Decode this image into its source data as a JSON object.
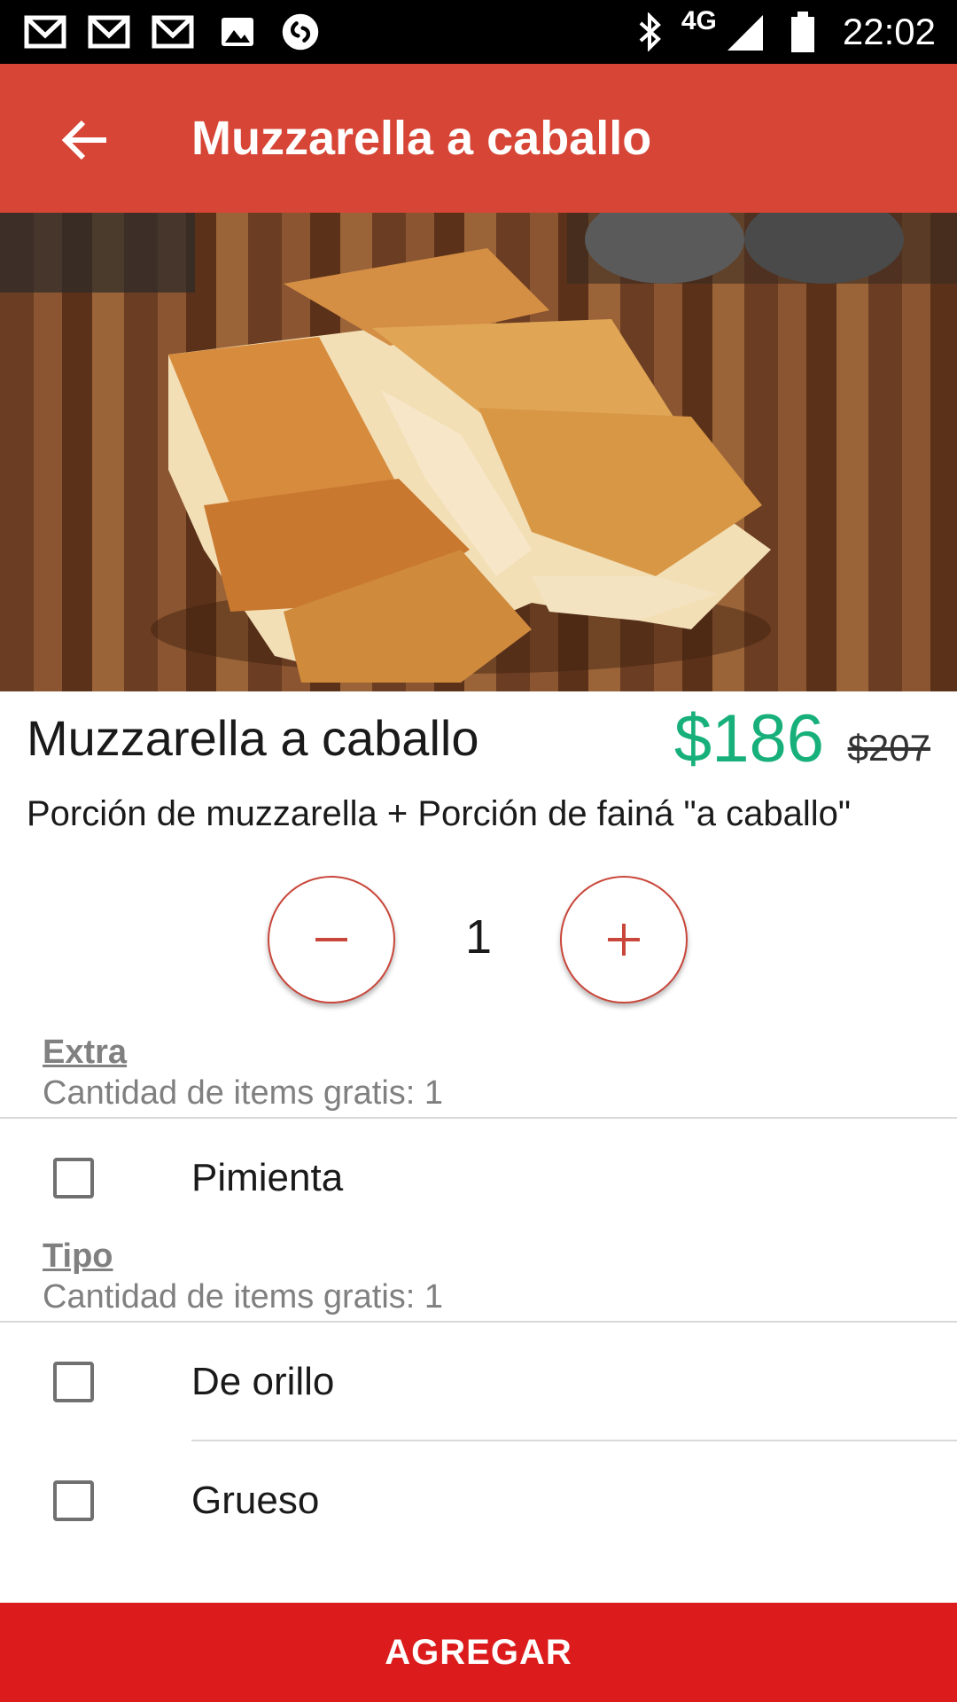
{
  "status_bar": {
    "time": "22:02",
    "network": "4G",
    "left_icons": [
      "gmail-icon",
      "gmail-icon",
      "gmail-icon",
      "image-icon",
      "shazam-icon"
    ],
    "right_icons": [
      "bluetooth-icon",
      "signal-icon",
      "battery-icon"
    ]
  },
  "app_bar": {
    "title": "Muzzarella a caballo",
    "back_icon": "arrow-back-icon",
    "color": "#d64535"
  },
  "product": {
    "image_alt": "pizza and fainá slices on wooden board",
    "name": "Muzzarella a caballo",
    "price": "$186",
    "old_price": "$207",
    "description": "Porción de muzzarella + Porción de fainá \"a caballo\"",
    "price_color": "#17b07a"
  },
  "quantity": {
    "value": "1",
    "minus_icon": "minus-icon",
    "plus_icon": "plus-icon"
  },
  "groups": [
    {
      "title": "Extra",
      "subtitle": "Cantidad de items gratis: 1",
      "options": [
        {
          "label": "Pimienta",
          "checked": false
        }
      ]
    },
    {
      "title": "Tipo",
      "subtitle": "Cantidad de items gratis: 1",
      "options": [
        {
          "label": "De orillo",
          "checked": false
        },
        {
          "label": "Grueso",
          "checked": false
        }
      ]
    }
  ],
  "add_button": {
    "label": "AGREGAR",
    "color": "#dc1c1c"
  }
}
